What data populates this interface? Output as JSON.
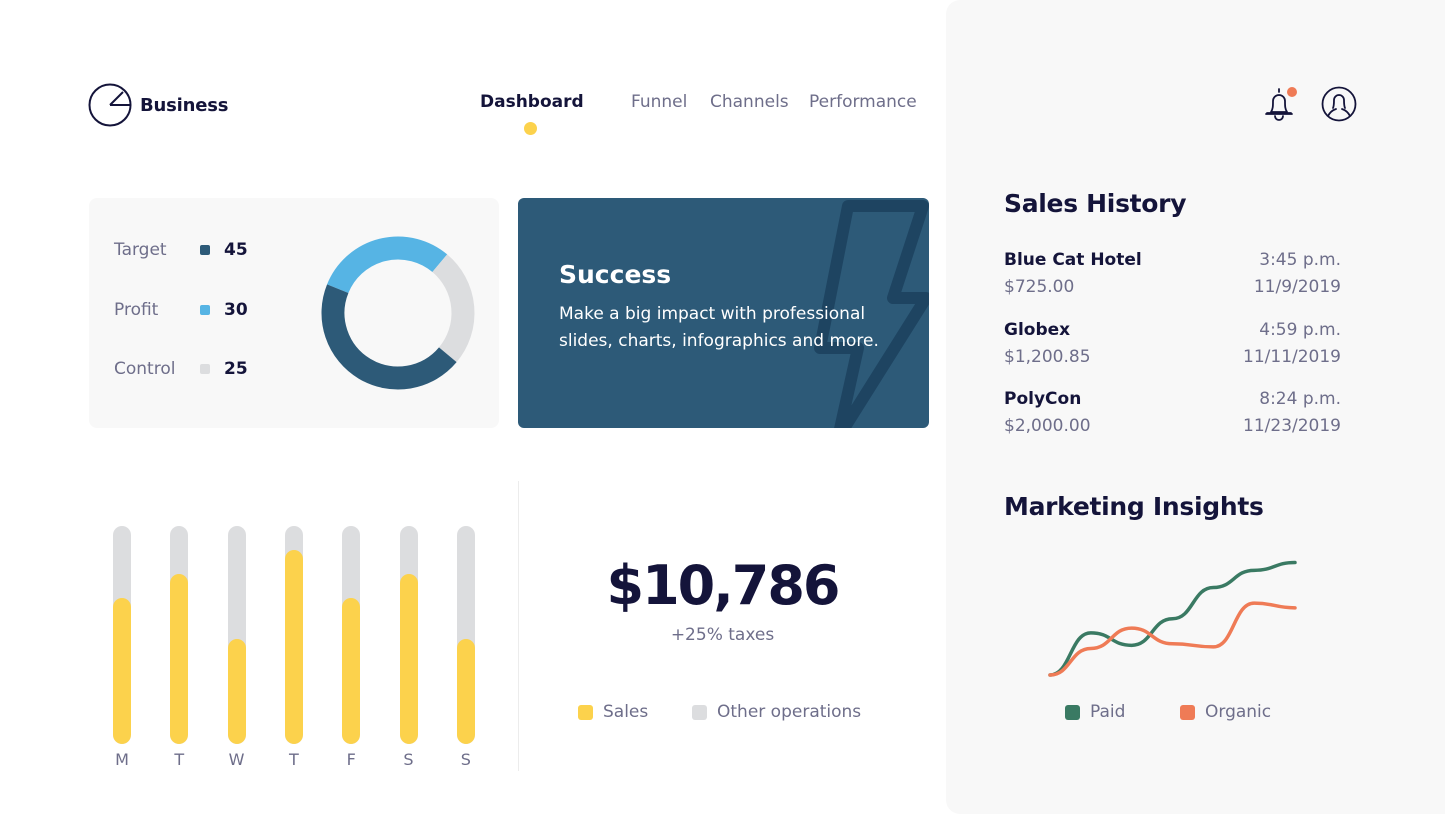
{
  "header": {
    "brand": "Business",
    "nav": [
      {
        "label": "Dashboard",
        "active": true
      },
      {
        "label": "Funnel",
        "active": false
      },
      {
        "label": "Channels",
        "active": false
      },
      {
        "label": "Performance",
        "active": false
      }
    ],
    "icons": {
      "logo": "pie-chart-icon",
      "notifications": "bell-icon",
      "profile": "user-icon"
    },
    "notification_badge_color": "#ef7b56"
  },
  "colors": {
    "navy": "#14143a",
    "dark_blue": "#2d5a78",
    "light_blue": "#56b4e4",
    "grey": "#dcdddf",
    "yellow": "#fcd24c",
    "green": "#3a7a63",
    "orange": "#ef7b56"
  },
  "donut_card": {
    "items": [
      {
        "label": "Target",
        "value": "45",
        "color": "#2d5a78"
      },
      {
        "label": "Profit",
        "value": "30",
        "color": "#56b4e4"
      },
      {
        "label": "Control",
        "value": "25",
        "color": "#dcdddf"
      }
    ]
  },
  "success_card": {
    "title": "Success",
    "text": "Make a big impact with professional slides, charts, infographics and more.",
    "icon": "lightning-bolt-icon"
  },
  "sales_summary": {
    "total": "$10,786",
    "subtitle": "+25% taxes",
    "legend": [
      {
        "label": "Sales",
        "color": "#fcd24c"
      },
      {
        "label": "Other operations",
        "color": "#dcdddf"
      }
    ]
  },
  "sales_history": {
    "title": "Sales History",
    "entries": [
      {
        "name": "Blue Cat Hotel",
        "amount": "$725.00",
        "time": "3:45 p.m.",
        "date": "11/9/2019"
      },
      {
        "name": "Globex",
        "amount": "$1,200.85",
        "time": "4:59 p.m.",
        "date": "11/11/2019"
      },
      {
        "name": "PolyCon",
        "amount": "$2,000.00",
        "time": "8:24 p.m.",
        "date": "11/23/2019"
      }
    ]
  },
  "marketing": {
    "title": "Marketing Insights",
    "legend": [
      {
        "label": "Paid",
        "color": "#3a7a63"
      },
      {
        "label": "Organic",
        "color": "#ef7b56"
      }
    ]
  },
  "chart_data": [
    {
      "type": "pie",
      "title": "",
      "donut": true,
      "categories": [
        "Target",
        "Profit",
        "Control"
      ],
      "values": [
        45,
        30,
        25
      ],
      "colors": [
        "#2d5a78",
        "#56b4e4",
        "#dcdddf"
      ]
    },
    {
      "type": "bar",
      "title": "",
      "categories": [
        "M",
        "T",
        "W",
        "T",
        "F",
        "S",
        "S"
      ],
      "series": [
        {
          "name": "Sales",
          "values": [
            0.67,
            0.78,
            0.48,
            0.89,
            0.67,
            0.78,
            0.48
          ],
          "color": "#fcd24c"
        },
        {
          "name": "Other operations",
          "values": [
            0.33,
            0.22,
            0.52,
            0.11,
            0.33,
            0.22,
            0.52
          ],
          "color": "#dcdddf"
        }
      ],
      "stacked": true,
      "ylim": [
        0,
        1
      ],
      "xlabel": "",
      "ylabel": "",
      "grid": false
    },
    {
      "type": "line",
      "title": "Marketing Insights",
      "x": [
        0,
        1,
        2,
        3,
        4,
        5,
        6
      ],
      "series": [
        {
          "name": "Paid",
          "values": [
            0,
            2.7,
            1.9,
            3.6,
            5.6,
            6.7,
            7.2
          ],
          "color": "#3a7a63"
        },
        {
          "name": "Organic",
          "values": [
            0,
            1.7,
            3.0,
            2.0,
            1.8,
            4.6,
            4.3
          ],
          "color": "#ef7b56"
        }
      ],
      "ylim": [
        0,
        8
      ],
      "legend": "bottom",
      "grid": false,
      "xlabel": "",
      "ylabel": ""
    }
  ]
}
